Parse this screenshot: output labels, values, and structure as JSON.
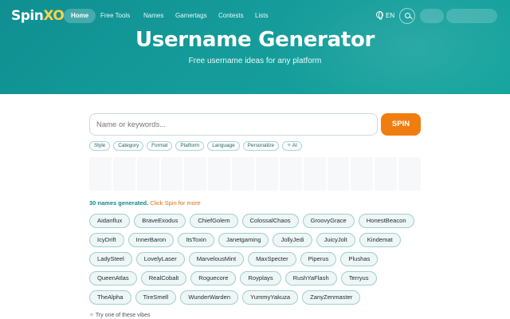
{
  "header": {
    "logo_main": "Spin",
    "logo_accent": "XO",
    "nav": [
      "Home",
      "Free Tools",
      "Names",
      "Gamertags",
      "Contests",
      "Lists"
    ],
    "active_nav": "Home",
    "language": "EN"
  },
  "hero": {
    "title": "Username Generator",
    "subtitle": "Free username ideas for any platform"
  },
  "search": {
    "placeholder": "Name or keywords...",
    "value": "",
    "spin_label": "SPIN"
  },
  "filters": [
    "Style",
    "Category",
    "Format",
    "Platform",
    "Language",
    "Personalize",
    "AI"
  ],
  "results": {
    "count_text": "30 names generated.",
    "hint_text": "Click Spin for more",
    "names": [
      "Aidanflux",
      "BraveExodus",
      "ChiefGolem",
      "ColossalChaos",
      "GroovyGrace",
      "HonestBeacon",
      "IcyDrift",
      "InnerBaron",
      "ItsToxin",
      "Janetgaming",
      "JollyJedi",
      "JuicyJolt",
      "Kindemat",
      "LadySteel",
      "LovelyLaser",
      "MarvelousMint",
      "MaxSpecter",
      "Piperus",
      "Plushas",
      "QueenAtlas",
      "RealCobalt",
      "Roguecore",
      "Royplays",
      "RushYaFlash",
      "Terryus",
      "TheAlpha",
      "TireSmell",
      "WunderWarden",
      "YummyYakuza",
      "ZanyZenmaster"
    ]
  },
  "vibes": {
    "label": "Try one of these vibes"
  },
  "colors": {
    "brand_teal": "#139a98",
    "spin_orange": "#ef7d10",
    "chip_bg": "#eef6f6"
  }
}
